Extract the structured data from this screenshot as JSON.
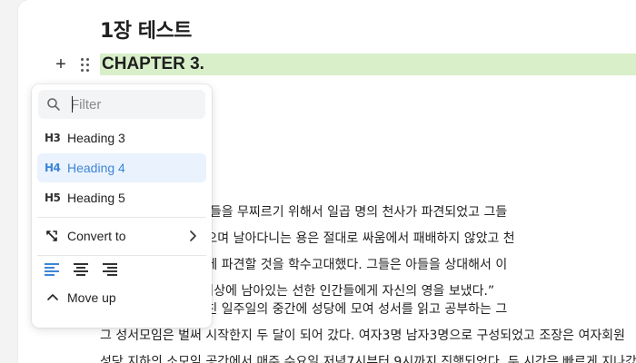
{
  "document": {
    "title": "1장 테스트",
    "chapter_heading": "CHAPTER 3.",
    "paragraph_1": [
      "의 용이 일어났다. 그들을 무찌르기 위해서 일곱 명의 천사가 파견되었고 그들",
      "를 가지고 불을 내뿜으며 날아다니는 용은 절대로 싸움에서 패배하지 않았고 천",
      "의 아들을 다시 지상에 파견할 것을 학수고대했다. 그들은 아들을 상대해서 이",
      ". 좋았다. 하느님은 지상에 남아있는 선한 인간들에게 자신의 영을 보냈다.”"
    ],
    "paragraph_2": [
      "나의 활력소였다. 지친 일주일의 중간에 성당에 모여 성서를 읽고 공부하는 그",
      "그 성서모임은 벌써 시작한지 두 달이 되어 갔다. 여자3명 남자3명으로 구성되었고 조장은 여자회원",
      "성당 지하의 소모임 공간에서 매주 수요일 저녁7시부터 9시까지 진행되었다. 두 시간은 빠르게 지나갔"
    ]
  },
  "block_controls": {
    "add_symbol": "+"
  },
  "slash_menu": {
    "filter_placeholder": "Filter",
    "filter_value": "",
    "headings": [
      {
        "icon": "H3",
        "label": "Heading 3",
        "active": false
      },
      {
        "icon": "H4",
        "label": "Heading 4",
        "active": true
      },
      {
        "icon": "H5",
        "label": "Heading 5",
        "active": false
      }
    ],
    "convert_label": "Convert to",
    "alignment_options": [
      "align-left",
      "align-center",
      "align-right"
    ],
    "active_alignment": "align-left",
    "move_up_label": "Move up"
  },
  "colors": {
    "accent": "#3d86d6",
    "active_item_bg": "#e9f2fd",
    "chapter_highlight": "#d8efc9"
  }
}
